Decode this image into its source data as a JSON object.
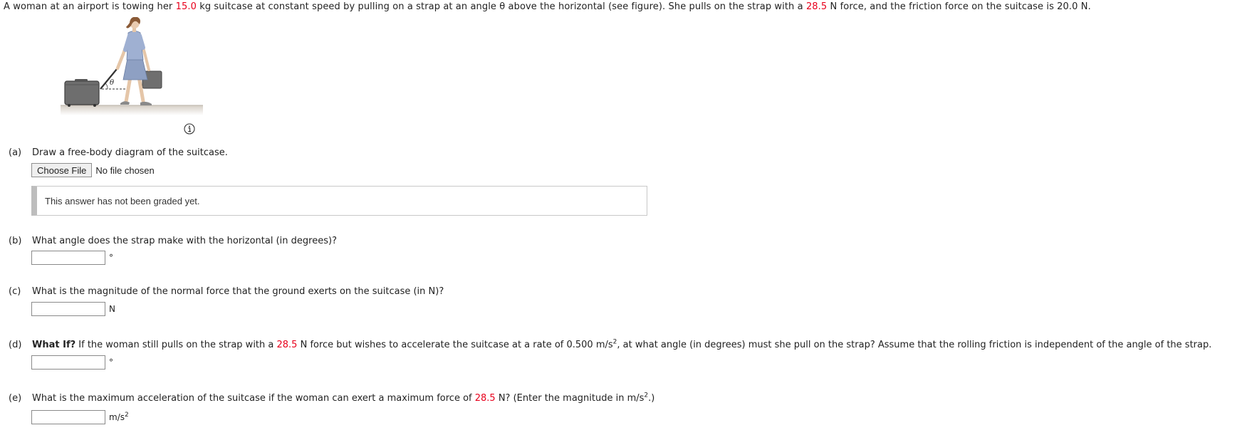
{
  "intro": {
    "t1": "A woman at an airport is towing her ",
    "mass": "15.0",
    "t2": " kg suitcase at constant speed by pulling on a strap at an angle θ above the horizontal (see figure). She pulls on the strap with a ",
    "force": "28.5",
    "t3": " N force, and the friction force on the suitcase is 20.0 N."
  },
  "figure": {
    "angle_symbol": "θ",
    "icon": "woman-towing-suitcase-illustration"
  },
  "part_a": {
    "label": "(a)",
    "question": "Draw a free-body diagram of the suitcase.",
    "choose_file": "Choose File",
    "no_file": "No file chosen",
    "status": "This answer has not been graded yet."
  },
  "part_b": {
    "label": "(b)",
    "question": "What angle does the strap make with the horizontal (in degrees)?",
    "unit": "°",
    "value": ""
  },
  "part_c": {
    "label": "(c)",
    "question": "What is the magnitude of the normal force that the ground exerts on the suitcase (in N)?",
    "unit": "N",
    "value": ""
  },
  "part_d": {
    "label": "(d)",
    "bold": "What If?",
    "t1": " If the woman still pulls on the strap with a ",
    "force": "28.5",
    "t2": " N force but wishes to accelerate the suitcase at a rate of 0.500 m/s",
    "t2_sup": "2",
    "t3": ", at what angle (in degrees) must she pull on the strap? Assume that the rolling friction is independent of the angle of the strap.",
    "unit": "°",
    "value": ""
  },
  "part_e": {
    "label": "(e)",
    "t1": "What is the maximum acceleration of the suitcase if the woman can exert a maximum force of ",
    "force": "28.5",
    "t2": " N? (Enter the magnitude in m/s",
    "t2_sup": "2",
    "t3": ".)",
    "unit": "m/s",
    "unit_sup": "2",
    "value": ""
  },
  "colors": {
    "highlight": "#e8001c",
    "text": "#222222"
  }
}
